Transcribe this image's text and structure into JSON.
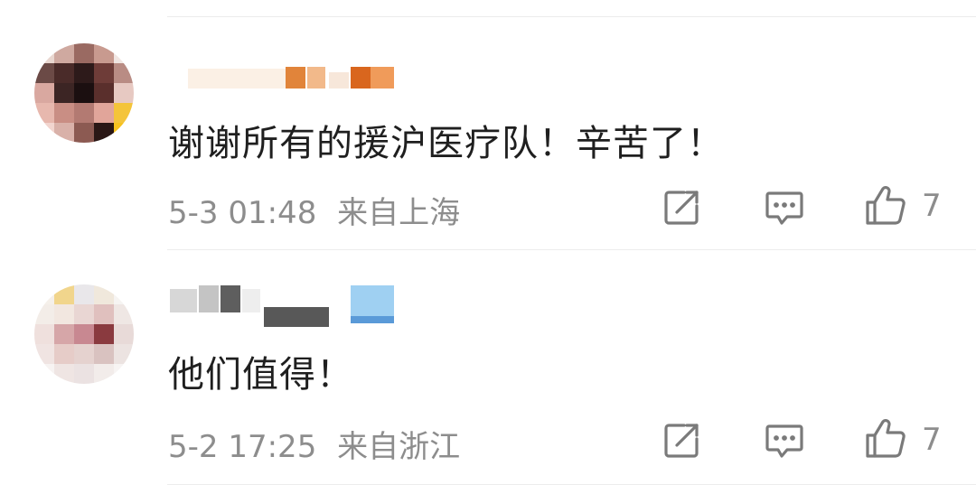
{
  "comments": [
    {
      "text": "谢谢所有的援沪医疗队！辛苦了！",
      "time": "5-3 01:48",
      "location": "来自上海",
      "likes": "7",
      "icons": {
        "share": "share-icon",
        "reply": "comment-icon",
        "like": "thumbs-up-icon"
      }
    },
    {
      "text": "他们值得！",
      "time": "5-2 17:25",
      "location": "来自浙江",
      "likes": "7",
      "icons": {
        "share": "share-icon",
        "reply": "comment-icon",
        "like": "thumbs-up-icon"
      }
    }
  ],
  "colors": {
    "text": "#1f1f1f",
    "meta": "#8d8d8d",
    "divider": "#ececec",
    "icon": "#7a7a7a"
  }
}
